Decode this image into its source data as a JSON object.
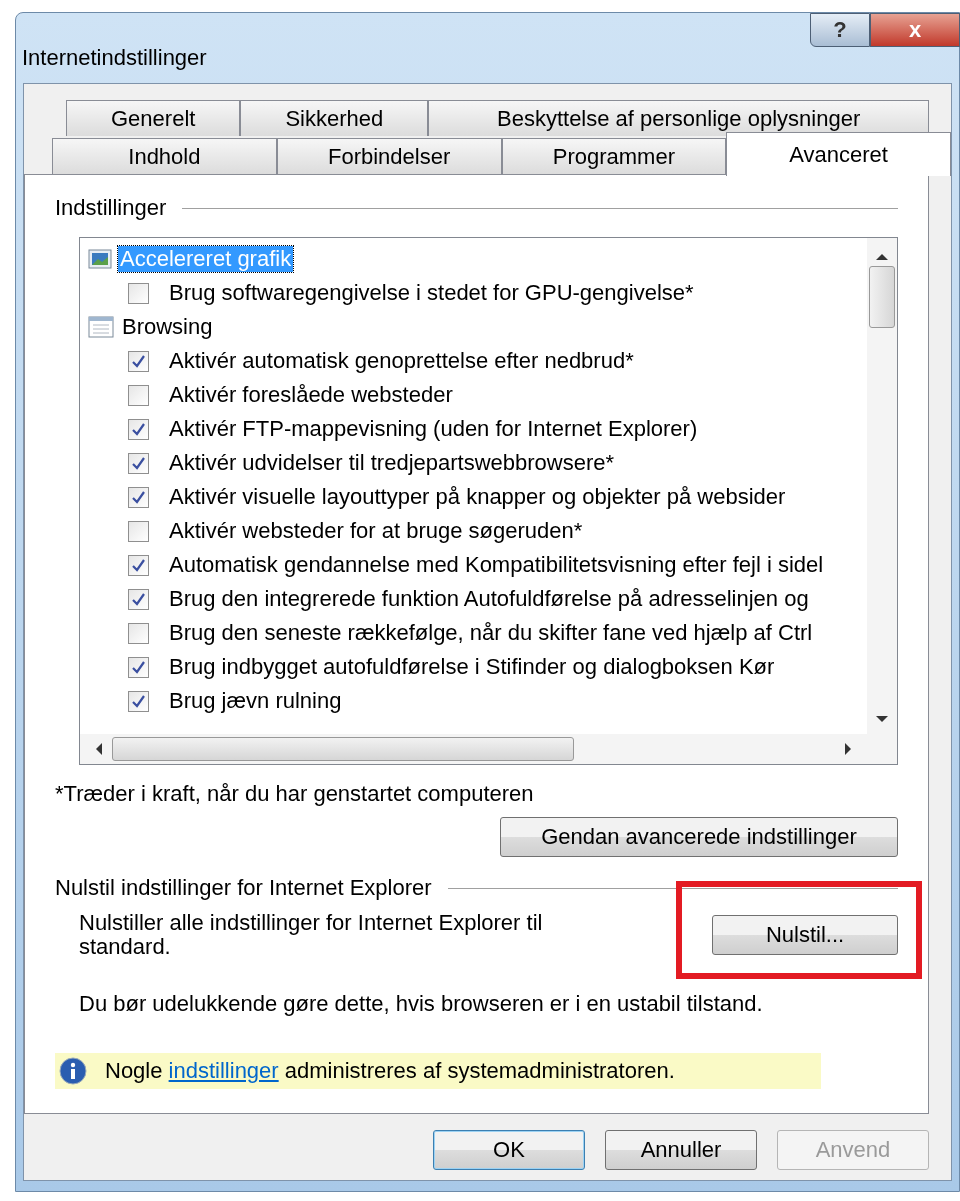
{
  "window": {
    "title": "Internetindstillinger",
    "help_button": "?",
    "close_button": "x"
  },
  "tabs": [
    [
      {
        "label": "Generelt",
        "selected": false
      },
      {
        "label": "Sikkerhed",
        "selected": false
      },
      {
        "label": "Beskyttelse af personlige oplysninger",
        "selected": false
      }
    ],
    [
      {
        "label": "Indhold",
        "selected": false
      },
      {
        "label": "Forbindelser",
        "selected": false
      },
      {
        "label": "Programmer",
        "selected": false
      },
      {
        "label": "Avanceret",
        "selected": true
      }
    ]
  ],
  "settings_group": {
    "title": "Indstillinger",
    "items": [
      {
        "kind": "category",
        "label": "Accelereret grafik",
        "selected": true
      },
      {
        "kind": "checkbox",
        "label": "Brug softwaregengivelse i stedet for GPU-gengivelse*",
        "checked": false
      },
      {
        "kind": "category",
        "label": "Browsing",
        "selected": false
      },
      {
        "kind": "checkbox",
        "label": "Aktivér automatisk genoprettelse efter nedbrud*",
        "checked": true
      },
      {
        "kind": "checkbox",
        "label": "Aktivér foreslåede websteder",
        "checked": false
      },
      {
        "kind": "checkbox",
        "label": "Aktivér FTP-mappevisning (uden for Internet Explorer)",
        "checked": true
      },
      {
        "kind": "checkbox",
        "label": "Aktivér udvidelser til tredjepartswebbrowsere*",
        "checked": true
      },
      {
        "kind": "checkbox",
        "label": "Aktivér visuelle layouttyper på knapper og objekter på websider",
        "checked": true
      },
      {
        "kind": "checkbox",
        "label": "Aktivér websteder for at bruge søgeruden*",
        "checked": false
      },
      {
        "kind": "checkbox",
        "label": "Automatisk gendannelse med Kompatibilitetsvisning efter fejl i sidel",
        "checked": true
      },
      {
        "kind": "checkbox",
        "label": "Brug den integrerede funktion Autofuldførelse på adresselinjen og",
        "checked": true
      },
      {
        "kind": "checkbox",
        "label": "Brug den seneste rækkefølge, når du skifter fane ved hjælp af Ctrl",
        "checked": false
      },
      {
        "kind": "checkbox",
        "label": "Brug indbygget autofuldførelse i Stifinder og dialogboksen Kør",
        "checked": true
      },
      {
        "kind": "checkbox",
        "label": "Brug jævn rulning",
        "checked": true
      }
    ],
    "note": "*Træder i kraft, når du har genstartet computeren",
    "restore_button": "Gendan avancerede indstillinger"
  },
  "reset_group": {
    "title": "Nulstil indstillinger for Internet Explorer",
    "description": "Nulstiller alle indstillinger for Internet Explorer til standard.",
    "reset_button": {
      "label": "Nulstil...",
      "highlighted": true
    },
    "warning": "Du bør udelukkende gøre dette, hvis browseren er i en ustabil tilstand."
  },
  "info_bar": {
    "before": "Nogle",
    "link": "indstillinger",
    "after": "administreres af systemadministratoren."
  },
  "buttons": [
    {
      "label": "OK",
      "default": true,
      "disabled": false
    },
    {
      "label": "Annuller",
      "default": false,
      "disabled": false
    },
    {
      "label": "Anvend",
      "default": false,
      "disabled": true
    }
  ]
}
